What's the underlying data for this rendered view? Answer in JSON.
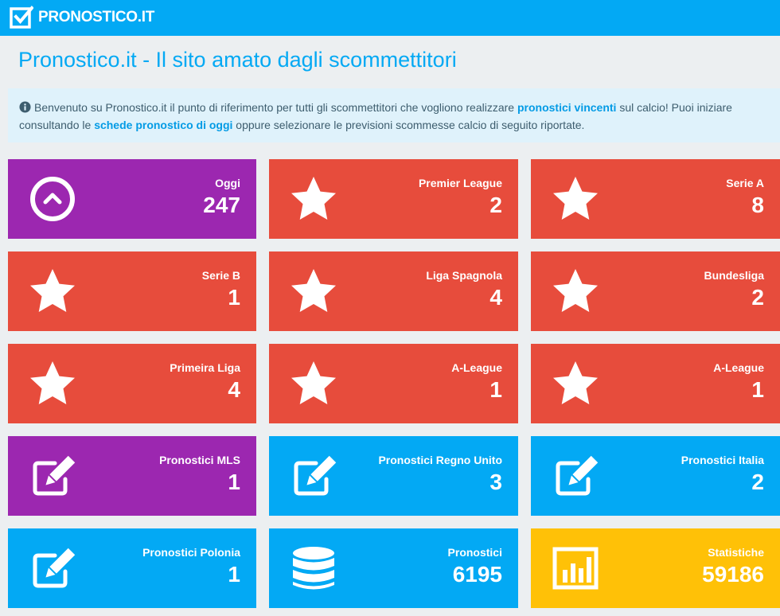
{
  "header": {
    "logo_text": "PRONOSTICO.IT"
  },
  "page": {
    "title": "Pronostico.it - Il sito amato dagli scommettitori"
  },
  "intro": {
    "t1": "Benvenuto su Pronostico.it il punto di riferimento per tutti gli scommettitori che vogliono realizzare ",
    "b1": "pronostici vincenti",
    "t2": " sul calcio! Puoi iniziare consultando le ",
    "b2": "schede pronostico di oggi",
    "t3": " oppure selezionare le previsioni scommesse calcio di seguito riportate."
  },
  "colors": {
    "header": "#03a9f4",
    "purple": "#9c27b0",
    "red": "#e74c3c",
    "blue": "#03a9f4",
    "yellow": "#ffc107"
  },
  "tiles": [
    {
      "label": "Oggi",
      "value": "247",
      "icon": "chevron-up-circle-icon",
      "color": "purple"
    },
    {
      "label": "Premier League",
      "value": "2",
      "icon": "star-icon",
      "color": "red"
    },
    {
      "label": "Serie A",
      "value": "8",
      "icon": "star-icon",
      "color": "red"
    },
    {
      "label": "Serie B",
      "value": "1",
      "icon": "star-icon",
      "color": "red"
    },
    {
      "label": "Liga Spagnola",
      "value": "4",
      "icon": "star-icon",
      "color": "red"
    },
    {
      "label": "Bundesliga",
      "value": "2",
      "icon": "star-icon",
      "color": "red"
    },
    {
      "label": "Primeira Liga",
      "value": "4",
      "icon": "star-icon",
      "color": "red"
    },
    {
      "label": "A-League",
      "value": "1",
      "icon": "star-icon",
      "color": "red"
    },
    {
      "label": "A-League",
      "value": "1",
      "icon": "star-icon",
      "color": "red"
    },
    {
      "label": "Pronostici MLS",
      "value": "1",
      "icon": "edit-icon",
      "color": "purple"
    },
    {
      "label": "Pronostici Regno Unito",
      "value": "3",
      "icon": "edit-icon",
      "color": "blue"
    },
    {
      "label": "Pronostici Italia",
      "value": "2",
      "icon": "edit-icon",
      "color": "blue"
    },
    {
      "label": "Pronostici Polonia",
      "value": "1",
      "icon": "edit-icon",
      "color": "blue"
    },
    {
      "label": "Pronostici",
      "value": "6195",
      "icon": "database-icon",
      "color": "blue"
    },
    {
      "label": "Statistiche",
      "value": "59186",
      "icon": "bar-chart-icon",
      "color": "yellow"
    }
  ]
}
